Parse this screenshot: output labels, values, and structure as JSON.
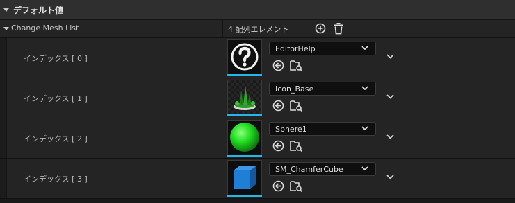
{
  "section": {
    "title": "デフォルト値"
  },
  "array": {
    "label": "Change Mesh List",
    "count": "4 配列エレメント",
    "add_icon": "plus-circle-icon",
    "clear_icon": "trash-icon"
  },
  "elements": [
    {
      "index_label": "インデックス [ 0 ]",
      "asset": "EditorHelp",
      "thumb": "question-mark-help"
    },
    {
      "index_label": "インデックス [ 1 ]",
      "asset": "Icon_Base",
      "thumb": "plant-base"
    },
    {
      "index_label": "インデックス [ 2 ]",
      "asset": "Sphere1",
      "thumb": "green-sphere"
    },
    {
      "index_label": "インデックス [ 3 ]",
      "asset": "SM_ChamferCube",
      "thumb": "blue-cube"
    }
  ],
  "colors": {
    "thumbnail_accent": "#26b5e8",
    "sphere": "#22e022",
    "cube": "#1f7fd6"
  }
}
